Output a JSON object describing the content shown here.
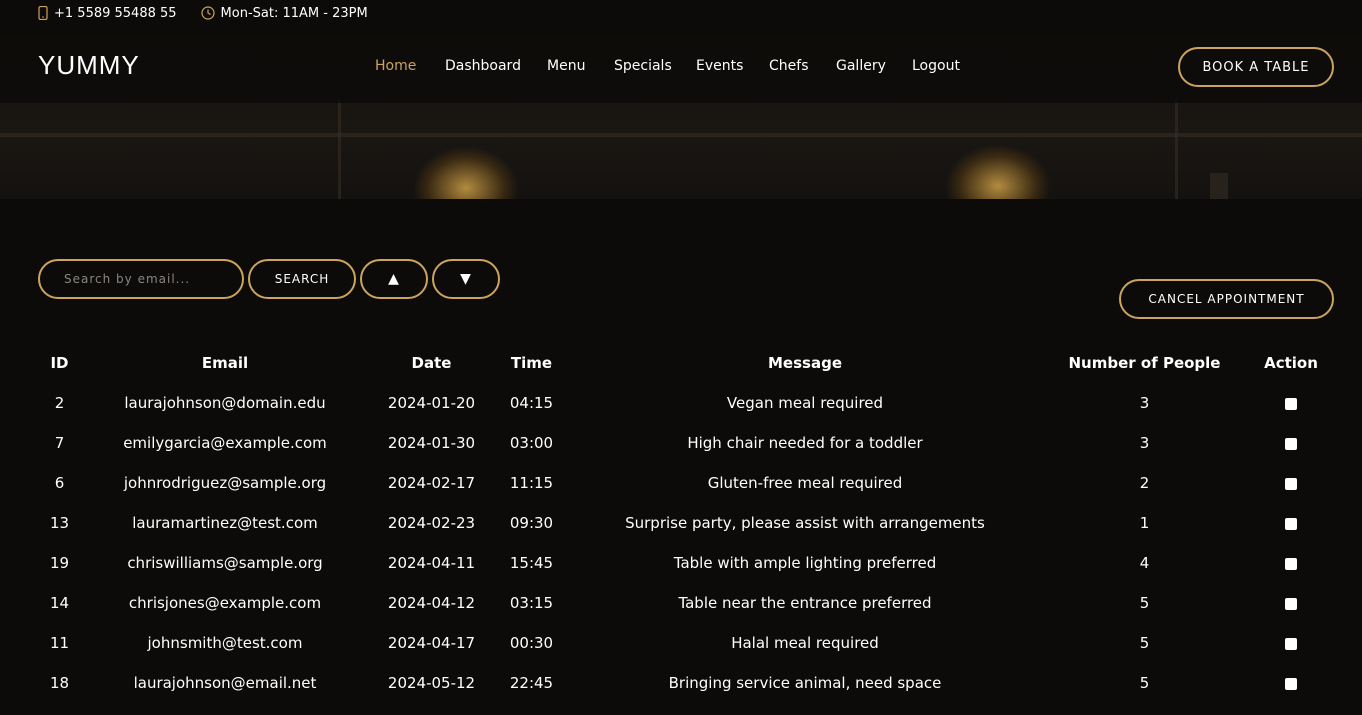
{
  "topbar": {
    "phone": "+1 5589 55488 55",
    "hours": "Mon-Sat: 11AM - 23PM"
  },
  "brand": {
    "name": "YUMMY"
  },
  "nav": {
    "items": [
      "Home",
      "Dashboard",
      "Menu",
      "Specials",
      "Events",
      "Chefs",
      "Gallery",
      "Logout"
    ],
    "active": "Home"
  },
  "book_button": "BOOK A TABLE",
  "search": {
    "placeholder": "Search by email...",
    "button": "SEARCH",
    "sort_up": "▲",
    "sort_down": "▼"
  },
  "cancel_button": "CANCEL APPOINTMENT",
  "colors": {
    "accent": "#cda45e",
    "background": "#0c0b09"
  },
  "table": {
    "headers": [
      "ID",
      "Email",
      "Date",
      "Time",
      "Message",
      "Number of People",
      "Action"
    ],
    "rows": [
      {
        "id": "2",
        "email": "laurajohnson@domain.edu",
        "date": "2024-01-20",
        "time": "04:15",
        "message": "Vegan meal required",
        "people": "3",
        "checked": false
      },
      {
        "id": "7",
        "email": "emilygarcia@example.com",
        "date": "2024-01-30",
        "time": "03:00",
        "message": "High chair needed for a toddler",
        "people": "3",
        "checked": false
      },
      {
        "id": "6",
        "email": "johnrodriguez@sample.org",
        "date": "2024-02-17",
        "time": "11:15",
        "message": "Gluten-free meal required",
        "people": "2",
        "checked": false
      },
      {
        "id": "13",
        "email": "lauramartinez@test.com",
        "date": "2024-02-23",
        "time": "09:30",
        "message": "Surprise party, please assist with arrangements",
        "people": "1",
        "checked": false
      },
      {
        "id": "19",
        "email": "chriswilliams@sample.org",
        "date": "2024-04-11",
        "time": "15:45",
        "message": "Table with ample lighting preferred",
        "people": "4",
        "checked": false
      },
      {
        "id": "14",
        "email": "chrisjones@example.com",
        "date": "2024-04-12",
        "time": "03:15",
        "message": "Table near the entrance preferred",
        "people": "5",
        "checked": false
      },
      {
        "id": "11",
        "email": "johnsmith@test.com",
        "date": "2024-04-17",
        "time": "00:30",
        "message": "Halal meal required",
        "people": "5",
        "checked": false
      },
      {
        "id": "18",
        "email": "laurajohnson@email.net",
        "date": "2024-05-12",
        "time": "22:45",
        "message": "Bringing service animal, need space",
        "people": "5",
        "checked": false
      }
    ]
  }
}
